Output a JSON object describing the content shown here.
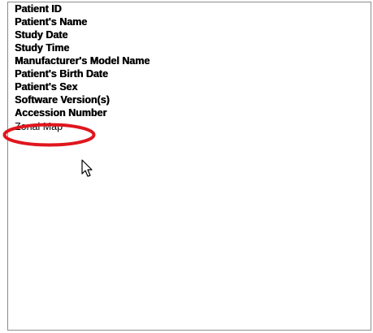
{
  "listbox": {
    "items": [
      {
        "label": "Patient ID"
      },
      {
        "label": "Patient's Name"
      },
      {
        "label": "Study Date"
      },
      {
        "label": "Study Time"
      },
      {
        "label": "Manufacturer's Model Name"
      },
      {
        "label": "Patient's Birth Date"
      },
      {
        "label": "Patient's Sex"
      },
      {
        "label": "Software Version(s)"
      },
      {
        "label": "Accession Number"
      },
      {
        "label": "Zonal Map"
      }
    ]
  },
  "colors": {
    "annotation": "#e0161d",
    "border": "#8c8c8c"
  },
  "cursor_icon": "arrow-pointer-icon"
}
